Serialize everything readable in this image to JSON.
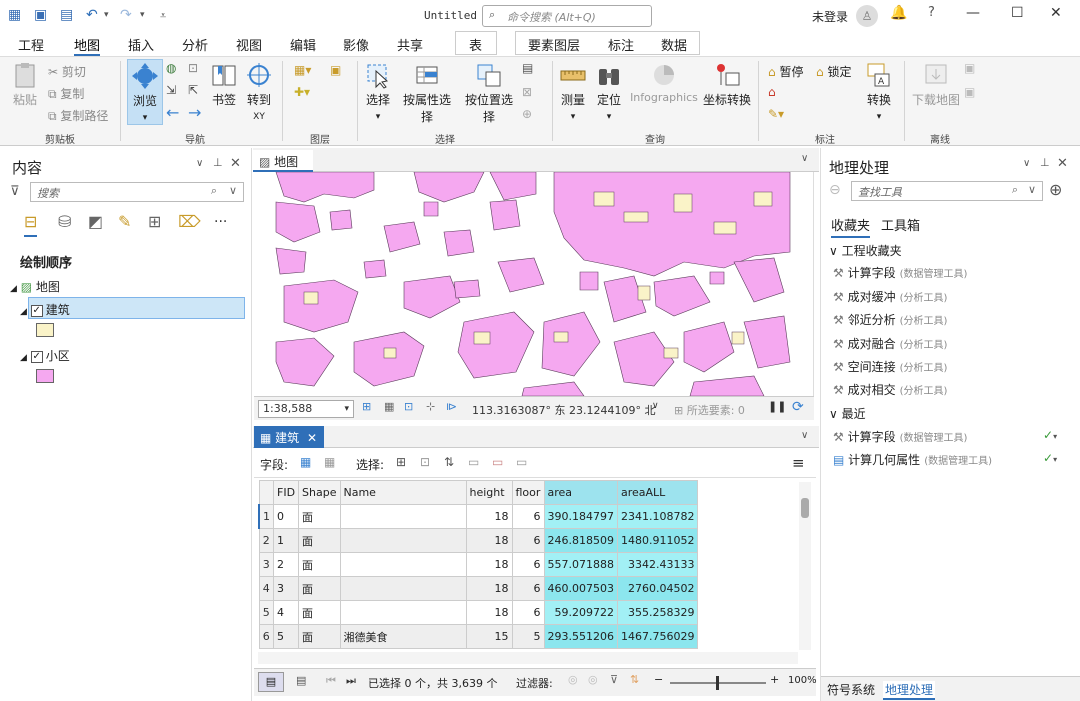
{
  "titlebar": {
    "title": "Untitled",
    "command_search_placeholder": "命令搜索 (Alt+Q)",
    "user": "未登录",
    "help": "?"
  },
  "tabs": [
    "工程",
    "地图",
    "插入",
    "分析",
    "视图",
    "编辑",
    "影像",
    "共享",
    "表",
    "要素图层",
    "标注",
    "数据"
  ],
  "active_tab": "地图",
  "ribbon": {
    "clipboard": {
      "paste": "粘贴",
      "cut": "剪切",
      "copy": "复制",
      "copy_path": "复制路径",
      "group": "剪贴板"
    },
    "navigate": {
      "explore": "浏览",
      "bookmarks": "书签",
      "goto": "转到",
      "goto_sub": "XY",
      "group": "导航"
    },
    "layer": {
      "group": "图层"
    },
    "selection": {
      "select": "选择",
      "by_attr": "按属性选择",
      "by_loc": "按位置选择",
      "group": "选择"
    },
    "inquiry": {
      "measure": "测量",
      "locate": "定位",
      "infographics": "Infographics",
      "convert": "坐标转换",
      "group": "查询"
    },
    "labeling": {
      "pause": "暂停",
      "lock": "锁定",
      "convert": "转换",
      "group": "标注"
    },
    "offline": {
      "download": "下载地图",
      "group": "离线"
    }
  },
  "contents": {
    "title": "内容",
    "search_placeholder": "搜索",
    "draw_order": "绘制顺序",
    "map": "地图",
    "layers": [
      {
        "name": "建筑",
        "checked": true,
        "swatch": "#faf3c8"
      },
      {
        "name": "小区",
        "checked": true,
        "swatch": "#f5a8f0"
      }
    ]
  },
  "map": {
    "tab": "地图",
    "scale": "1:38,588",
    "coords": "113.3163087° 东  23.1244109° 北",
    "selected_features": "所选要素: 0"
  },
  "attr_table": {
    "tab": "建筑",
    "field_label": "字段:",
    "select_label": "选择:",
    "columns": [
      "FID",
      "Shape",
      "Name",
      "height",
      "floor",
      "area",
      "areaALL"
    ],
    "rows": [
      {
        "n": "1",
        "fid": "0",
        "shape": "面",
        "name": "",
        "height": "18",
        "floor": "6",
        "area": "390.184797",
        "areaALL": "2341.108782"
      },
      {
        "n": "2",
        "fid": "1",
        "shape": "面",
        "name": "",
        "height": "18",
        "floor": "6",
        "area": "246.818509",
        "areaALL": "1480.911052"
      },
      {
        "n": "3",
        "fid": "2",
        "shape": "面",
        "name": "",
        "height": "18",
        "floor": "6",
        "area": "557.071888",
        "areaALL": "3342.43133"
      },
      {
        "n": "4",
        "fid": "3",
        "shape": "面",
        "name": "",
        "height": "18",
        "floor": "6",
        "area": "460.007503",
        "areaALL": "2760.04502"
      },
      {
        "n": "5",
        "fid": "4",
        "shape": "面",
        "name": "",
        "height": "18",
        "floor": "6",
        "area": "59.209722",
        "areaALL": "355.258329"
      },
      {
        "n": "6",
        "fid": "5",
        "shape": "面",
        "name": "湘德美食",
        "height": "15",
        "floor": "5",
        "area": "293.551206",
        "areaALL": "1467.756029"
      }
    ],
    "status": "已选择 0 个，共 3,639 个",
    "filter_label": "过滤器:",
    "zoom": "100%"
  },
  "geoprocessing": {
    "title": "地理处理",
    "search_placeholder": "查找工具",
    "tab_favorites": "收藏夹",
    "tab_toolboxes": "工具箱",
    "project_favorites": "工程收藏夹",
    "favorites": [
      {
        "name": "计算字段",
        "box": "(数据管理工具)"
      },
      {
        "name": "成对缓冲",
        "box": "(分析工具)"
      },
      {
        "name": "邻近分析",
        "box": "(分析工具)"
      },
      {
        "name": "成对融合",
        "box": "(分析工具)"
      },
      {
        "name": "空间连接",
        "box": "(分析工具)"
      },
      {
        "name": "成对相交",
        "box": "(分析工具)"
      }
    ],
    "recent_label": "最近",
    "recent": [
      {
        "name": "计算字段",
        "box": "(数据管理工具)"
      },
      {
        "name": "计算几何属性",
        "box": "(数据管理工具)"
      }
    ],
    "bottom_tabs": [
      "符号系统",
      "地理处理"
    ]
  },
  "colors": {
    "accent": "#2f6fb8",
    "building_fill": "#f5a8f0",
    "selected_col": "#a2f0f5"
  }
}
